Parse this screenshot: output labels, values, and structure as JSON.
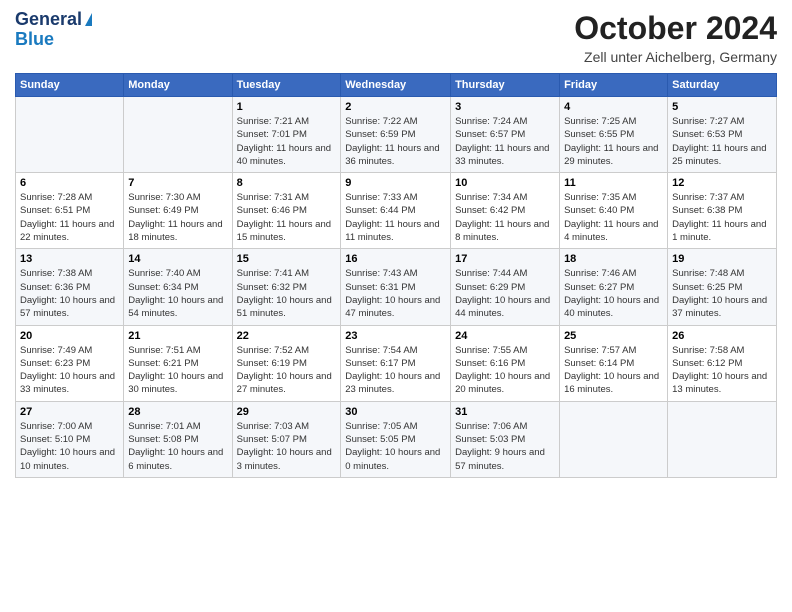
{
  "logo": {
    "line1": "General",
    "line2": "Blue"
  },
  "header": {
    "month": "October 2024",
    "location": "Zell unter Aichelberg, Germany"
  },
  "weekdays": [
    "Sunday",
    "Monday",
    "Tuesday",
    "Wednesday",
    "Thursday",
    "Friday",
    "Saturday"
  ],
  "weeks": [
    [
      {
        "day": "",
        "sunrise": "",
        "sunset": "",
        "daylight": ""
      },
      {
        "day": "",
        "sunrise": "",
        "sunset": "",
        "daylight": ""
      },
      {
        "day": "1",
        "sunrise": "Sunrise: 7:21 AM",
        "sunset": "Sunset: 7:01 PM",
        "daylight": "Daylight: 11 hours and 40 minutes."
      },
      {
        "day": "2",
        "sunrise": "Sunrise: 7:22 AM",
        "sunset": "Sunset: 6:59 PM",
        "daylight": "Daylight: 11 hours and 36 minutes."
      },
      {
        "day": "3",
        "sunrise": "Sunrise: 7:24 AM",
        "sunset": "Sunset: 6:57 PM",
        "daylight": "Daylight: 11 hours and 33 minutes."
      },
      {
        "day": "4",
        "sunrise": "Sunrise: 7:25 AM",
        "sunset": "Sunset: 6:55 PM",
        "daylight": "Daylight: 11 hours and 29 minutes."
      },
      {
        "day": "5",
        "sunrise": "Sunrise: 7:27 AM",
        "sunset": "Sunset: 6:53 PM",
        "daylight": "Daylight: 11 hours and 25 minutes."
      }
    ],
    [
      {
        "day": "6",
        "sunrise": "Sunrise: 7:28 AM",
        "sunset": "Sunset: 6:51 PM",
        "daylight": "Daylight: 11 hours and 22 minutes."
      },
      {
        "day": "7",
        "sunrise": "Sunrise: 7:30 AM",
        "sunset": "Sunset: 6:49 PM",
        "daylight": "Daylight: 11 hours and 18 minutes."
      },
      {
        "day": "8",
        "sunrise": "Sunrise: 7:31 AM",
        "sunset": "Sunset: 6:46 PM",
        "daylight": "Daylight: 11 hours and 15 minutes."
      },
      {
        "day": "9",
        "sunrise": "Sunrise: 7:33 AM",
        "sunset": "Sunset: 6:44 PM",
        "daylight": "Daylight: 11 hours and 11 minutes."
      },
      {
        "day": "10",
        "sunrise": "Sunrise: 7:34 AM",
        "sunset": "Sunset: 6:42 PM",
        "daylight": "Daylight: 11 hours and 8 minutes."
      },
      {
        "day": "11",
        "sunrise": "Sunrise: 7:35 AM",
        "sunset": "Sunset: 6:40 PM",
        "daylight": "Daylight: 11 hours and 4 minutes."
      },
      {
        "day": "12",
        "sunrise": "Sunrise: 7:37 AM",
        "sunset": "Sunset: 6:38 PM",
        "daylight": "Daylight: 11 hours and 1 minute."
      }
    ],
    [
      {
        "day": "13",
        "sunrise": "Sunrise: 7:38 AM",
        "sunset": "Sunset: 6:36 PM",
        "daylight": "Daylight: 10 hours and 57 minutes."
      },
      {
        "day": "14",
        "sunrise": "Sunrise: 7:40 AM",
        "sunset": "Sunset: 6:34 PM",
        "daylight": "Daylight: 10 hours and 54 minutes."
      },
      {
        "day": "15",
        "sunrise": "Sunrise: 7:41 AM",
        "sunset": "Sunset: 6:32 PM",
        "daylight": "Daylight: 10 hours and 51 minutes."
      },
      {
        "day": "16",
        "sunrise": "Sunrise: 7:43 AM",
        "sunset": "Sunset: 6:31 PM",
        "daylight": "Daylight: 10 hours and 47 minutes."
      },
      {
        "day": "17",
        "sunrise": "Sunrise: 7:44 AM",
        "sunset": "Sunset: 6:29 PM",
        "daylight": "Daylight: 10 hours and 44 minutes."
      },
      {
        "day": "18",
        "sunrise": "Sunrise: 7:46 AM",
        "sunset": "Sunset: 6:27 PM",
        "daylight": "Daylight: 10 hours and 40 minutes."
      },
      {
        "day": "19",
        "sunrise": "Sunrise: 7:48 AM",
        "sunset": "Sunset: 6:25 PM",
        "daylight": "Daylight: 10 hours and 37 minutes."
      }
    ],
    [
      {
        "day": "20",
        "sunrise": "Sunrise: 7:49 AM",
        "sunset": "Sunset: 6:23 PM",
        "daylight": "Daylight: 10 hours and 33 minutes."
      },
      {
        "day": "21",
        "sunrise": "Sunrise: 7:51 AM",
        "sunset": "Sunset: 6:21 PM",
        "daylight": "Daylight: 10 hours and 30 minutes."
      },
      {
        "day": "22",
        "sunrise": "Sunrise: 7:52 AM",
        "sunset": "Sunset: 6:19 PM",
        "daylight": "Daylight: 10 hours and 27 minutes."
      },
      {
        "day": "23",
        "sunrise": "Sunrise: 7:54 AM",
        "sunset": "Sunset: 6:17 PM",
        "daylight": "Daylight: 10 hours and 23 minutes."
      },
      {
        "day": "24",
        "sunrise": "Sunrise: 7:55 AM",
        "sunset": "Sunset: 6:16 PM",
        "daylight": "Daylight: 10 hours and 20 minutes."
      },
      {
        "day": "25",
        "sunrise": "Sunrise: 7:57 AM",
        "sunset": "Sunset: 6:14 PM",
        "daylight": "Daylight: 10 hours and 16 minutes."
      },
      {
        "day": "26",
        "sunrise": "Sunrise: 7:58 AM",
        "sunset": "Sunset: 6:12 PM",
        "daylight": "Daylight: 10 hours and 13 minutes."
      }
    ],
    [
      {
        "day": "27",
        "sunrise": "Sunrise: 7:00 AM",
        "sunset": "Sunset: 5:10 PM",
        "daylight": "Daylight: 10 hours and 10 minutes."
      },
      {
        "day": "28",
        "sunrise": "Sunrise: 7:01 AM",
        "sunset": "Sunset: 5:08 PM",
        "daylight": "Daylight: 10 hours and 6 minutes."
      },
      {
        "day": "29",
        "sunrise": "Sunrise: 7:03 AM",
        "sunset": "Sunset: 5:07 PM",
        "daylight": "Daylight: 10 hours and 3 minutes."
      },
      {
        "day": "30",
        "sunrise": "Sunrise: 7:05 AM",
        "sunset": "Sunset: 5:05 PM",
        "daylight": "Daylight: 10 hours and 0 minutes."
      },
      {
        "day": "31",
        "sunrise": "Sunrise: 7:06 AM",
        "sunset": "Sunset: 5:03 PM",
        "daylight": "Daylight: 9 hours and 57 minutes."
      },
      {
        "day": "",
        "sunrise": "",
        "sunset": "",
        "daylight": ""
      },
      {
        "day": "",
        "sunrise": "",
        "sunset": "",
        "daylight": ""
      }
    ]
  ]
}
